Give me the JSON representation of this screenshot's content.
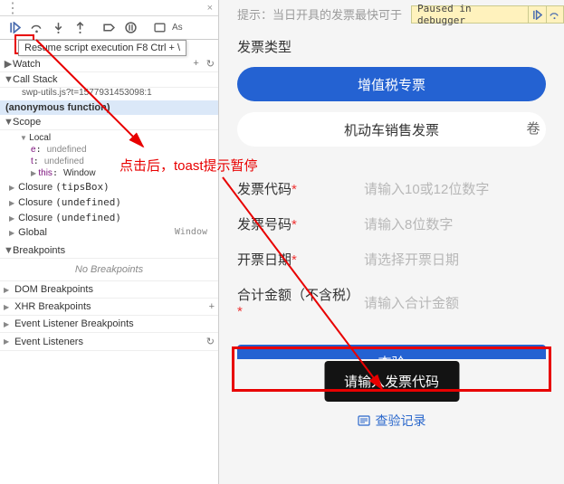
{
  "devtools": {
    "toolbar": {
      "as": "As"
    },
    "resume_tooltip": "Resume script execution   F8   Ctrl + \\",
    "watch": {
      "label": "Watch"
    },
    "call_stack": {
      "label": "Call Stack",
      "source": "swp-utils.js?t=1577931453098:1",
      "frame": "(anonymous function)"
    },
    "scope": {
      "label": "Scope",
      "local_label": "Local",
      "e": "e",
      "e_val": "undefined",
      "t": "t",
      "t_val": "undefined",
      "this": "this",
      "this_val": "Window",
      "closures": [
        {
          "label": "Closure",
          "detail": "(tipsBox)"
        },
        {
          "label": "Closure",
          "detail": "(undefined)"
        },
        {
          "label": "Closure",
          "detail": "(undefined)"
        },
        {
          "label": "Global",
          "detail": "Window"
        }
      ]
    },
    "breakpoints": {
      "label": "Breakpoints",
      "empty": "No Breakpoints"
    },
    "sections": {
      "dom": "DOM Breakpoints",
      "xhr": "XHR Breakpoints",
      "evt": "Event Listener Breakpoints",
      "listeners": "Event Listeners"
    }
  },
  "paused": {
    "text": "Paused in debugger"
  },
  "annotation": "点击后，toast提示暂停",
  "page": {
    "tip": "提示：当日开具的发票最快可于",
    "type_title": "发票类型",
    "tab_vat": "增值税专票",
    "tab_vehicle": "机动车销售发票",
    "tab_vehicle_right": "卷",
    "fields": {
      "code": {
        "label": "发票代码",
        "req": "*",
        "ph": "请输入10或12位数字"
      },
      "num": {
        "label": "发票号码",
        "req": "*",
        "ph": "请输入8位数字"
      },
      "date": {
        "label": "开票日期",
        "req": "*",
        "ph": "请选择开票日期"
      },
      "amt": {
        "label": "合计金额（不含税）",
        "req": "*",
        "ph": "请输入合计金额"
      }
    },
    "submit": "查验",
    "toast": "请输入发票代码",
    "history": "查验记录"
  }
}
